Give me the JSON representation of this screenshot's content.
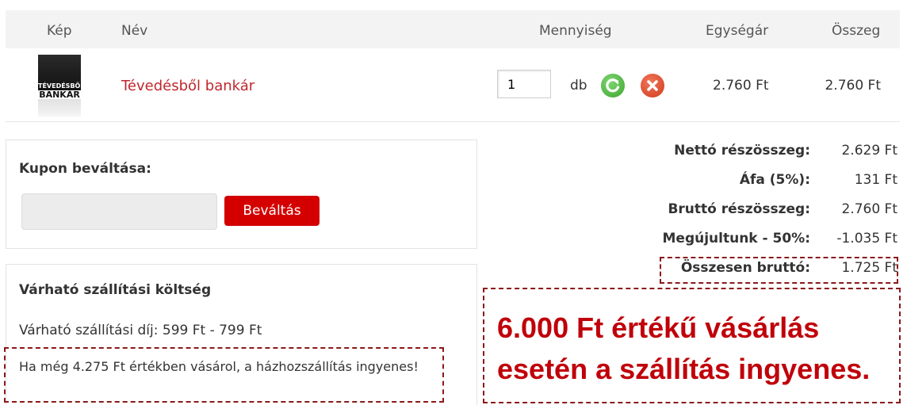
{
  "cart": {
    "headers": {
      "image": "Kép",
      "name": "Név",
      "quantity": "Mennyiség",
      "unit_price": "Egységár",
      "total": "Összeg"
    },
    "item": {
      "cover_title_1": "TÉVEDÉSBŐL",
      "cover_title_2": "BANKÁR",
      "name": "Tévedésből bankár",
      "quantity": "1",
      "unit": "db",
      "unit_price": "2.760 Ft",
      "total": "2.760 Ft",
      "icons": [
        "refresh-icon",
        "remove-icon"
      ],
      "colors": {
        "refresh": "#3ea52f",
        "remove": "#cf3b1c"
      }
    }
  },
  "coupon": {
    "title": "Kupon beváltása:",
    "input_value": "",
    "button_label": "Beváltás",
    "button_color": "#d40000"
  },
  "shipping": {
    "title": "Várható szállítási költség",
    "fee_text": "Várható szállítási díj: 599 Ft - 799 Ft",
    "free_note": "Ha még 4.275 Ft értékben vásárol, a házhozszállítás ingyenes!"
  },
  "totals": [
    {
      "label": "Nettó részösszeg:",
      "value": "2.629 Ft"
    },
    {
      "label": "Áfa (5%):",
      "value": "131 Ft"
    },
    {
      "label": "Bruttó részösszeg:",
      "value": "2.760 Ft"
    },
    {
      "label": "Megújultunk - 50%:",
      "value": "-1.035 Ft"
    },
    {
      "label": "Összesen bruttó:",
      "value": "1.725 Ft"
    }
  ],
  "promo": {
    "line1": "6.000 Ft értékű vásárlás",
    "line2": "esetén a szállítás ingyenes.",
    "color": "#c0000a"
  }
}
